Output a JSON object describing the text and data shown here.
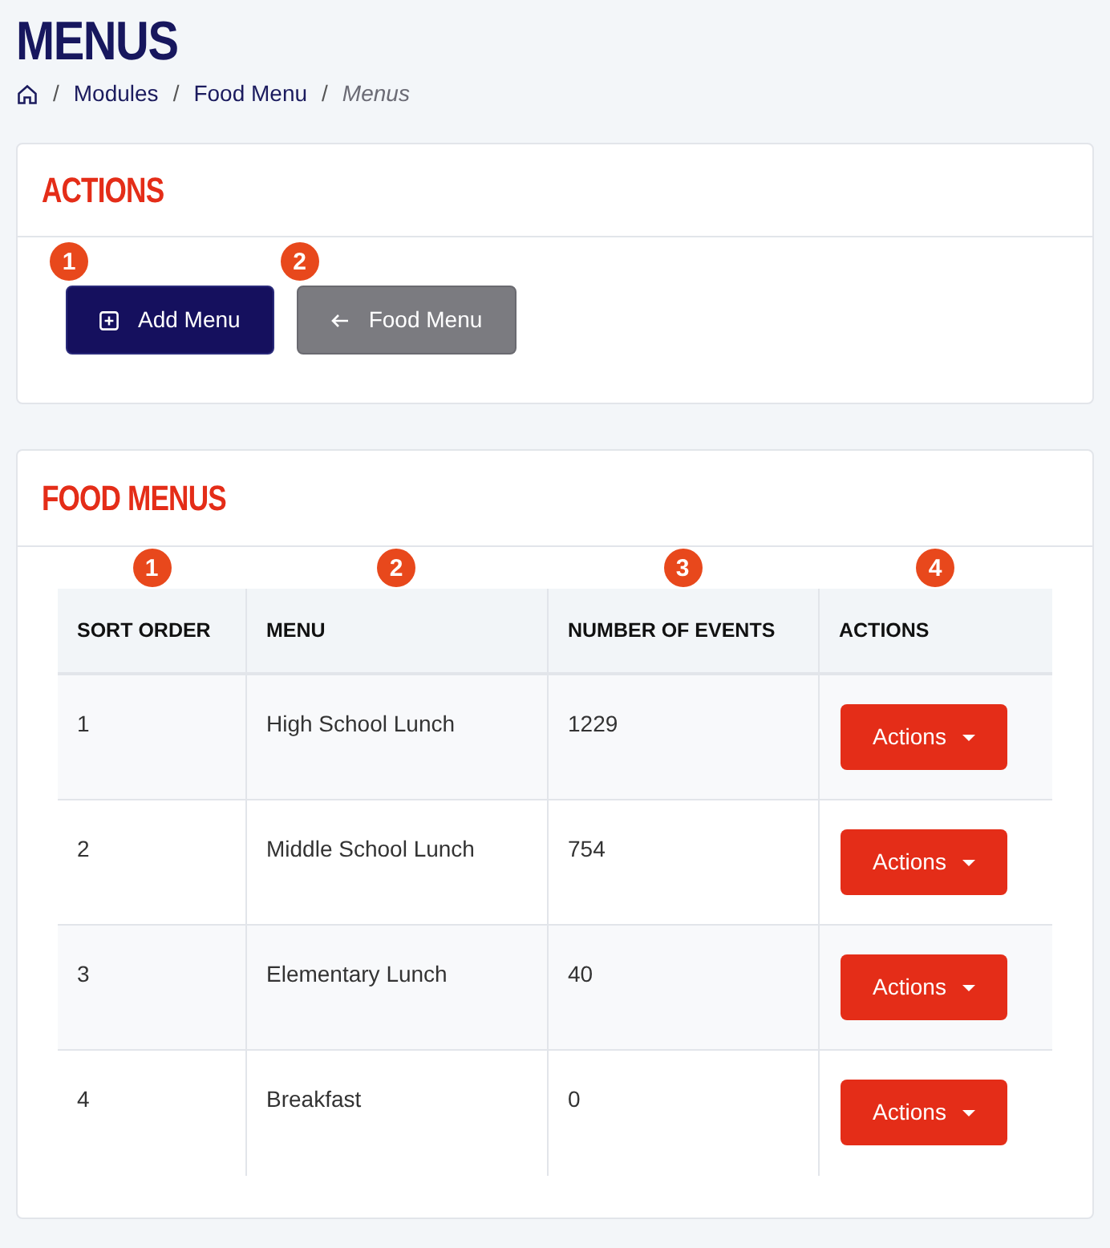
{
  "page_title": "MENUS",
  "breadcrumb": {
    "items": [
      {
        "label": "Modules",
        "current": false
      },
      {
        "label": "Food Menu",
        "current": false
      },
      {
        "label": "Menus",
        "current": true
      }
    ],
    "separator": "/"
  },
  "actions_card": {
    "title": "ACTIONS",
    "buttons": [
      {
        "label": "Add Menu",
        "callout": "1",
        "kind": "primary"
      },
      {
        "label": "Food Menu",
        "callout": "2",
        "kind": "back"
      }
    ]
  },
  "food_menus_card": {
    "title": "FOOD MENUS",
    "table": {
      "columns": [
        {
          "label": "SORT ORDER",
          "callout": "1"
        },
        {
          "label": "MENU",
          "callout": "2"
        },
        {
          "label": "NUMBER OF EVENTS",
          "callout": "3"
        },
        {
          "label": "ACTIONS",
          "callout": "4"
        }
      ],
      "rows": [
        {
          "sort_order": "1",
          "menu": "High School Lunch",
          "events": "1229",
          "action": "Actions"
        },
        {
          "sort_order": "2",
          "menu": "Middle School Lunch",
          "events": "754",
          "action": "Actions"
        },
        {
          "sort_order": "3",
          "menu": "Elementary Lunch",
          "events": "40",
          "action": "Actions"
        },
        {
          "sort_order": "4",
          "menu": "Breakfast",
          "events": "0",
          "action": "Actions"
        }
      ]
    }
  }
}
